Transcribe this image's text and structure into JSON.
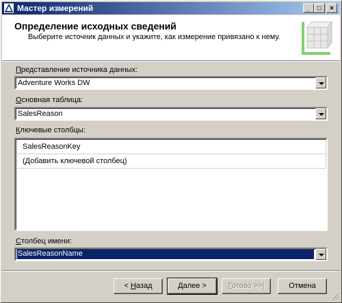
{
  "window": {
    "title": "Мастер измерений",
    "buttons": {
      "minimize": "_",
      "maximize": "□",
      "close": "×"
    }
  },
  "header": {
    "title": "Определение исходных сведений",
    "subtitle": "Выберите источник данных и укажите, как измерение привязано к нему."
  },
  "form": {
    "dsv_label_access": "П",
    "dsv_label_rest": "редставление источника данных:",
    "dsv_value": "Adventure Works DW",
    "main_table_label_access": "О",
    "main_table_label_rest": "сновная таблица:",
    "main_table_value": "SalesReason",
    "key_columns_label_access": "К",
    "key_columns_label_rest": "лючевые столбцы:",
    "key_columns": [
      "SalesReasonKey",
      "(Добавить ключевой столбец)"
    ],
    "name_column_label_access": "С",
    "name_column_label_rest": "толбец имени:",
    "name_column_value": "SalesReasonName"
  },
  "footer": {
    "back_prefix": "< ",
    "back_access": "Н",
    "back_rest": "азад",
    "next_access": "Д",
    "next_rest": "алее >",
    "finish_access": "Г",
    "finish_rest": "отово >>|",
    "cancel_label": "Отмена"
  },
  "colors": {
    "titlebar_start": "#0a246a",
    "titlebar_end": "#a6caf0",
    "selection": "#0a246a",
    "face": "#d4d0c8"
  }
}
